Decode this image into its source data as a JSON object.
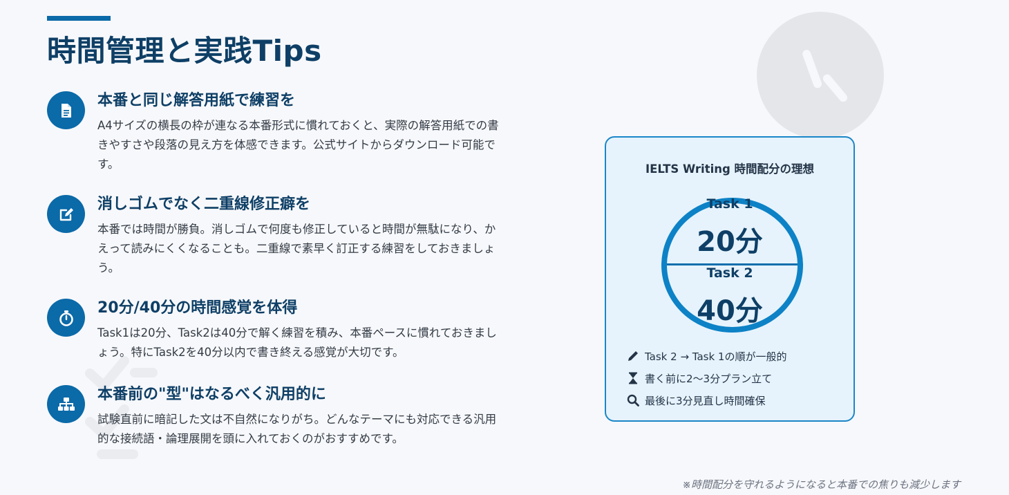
{
  "title": "時間管理と実践Tips",
  "colors": {
    "accent": "#0b6aa8",
    "heading": "#0e3f66",
    "card_bg": "#e6f3fc",
    "card_border": "#1a86c8"
  },
  "tips": [
    {
      "icon": "document-icon",
      "title": "本番と同じ解答用紙で練習を",
      "desc": "A4サイズの横長の枠が連なる本番形式に慣れておくと、実際の解答用紙での書きやすさや段落の見え方を体感できます。公式サイトからダウンロード可能です。"
    },
    {
      "icon": "edit-icon",
      "title": "消しゴムでなく二重線修正癖を",
      "desc": "本番では時間が勝負。消しゴムで何度も修正していると時間が無駄になり、かえって読みにくくなることも。二重線で素早く訂正する練習をしておきましょう。"
    },
    {
      "icon": "stopwatch-icon",
      "title": "20分/40分の時間感覚を体得",
      "desc": "Task1は20分、Task2は40分で解く練習を積み、本番ペースに慣れておきましょう。特にTask2を40分以内で書き終える感覚が大切です。"
    },
    {
      "icon": "sitemap-icon",
      "title": "本番前の\"型\"はなるべく汎用的に",
      "desc": "試験直前に暗記した文は不自然になりがち。どんなテーマにも対応できる汎用的な接続語・論理展開を頭に入れておくのがおすすめです。"
    }
  ],
  "card": {
    "title": "IELTS Writing 時間配分の理想",
    "task1_label": "Task 1",
    "task1_time": "20分",
    "task2_label": "Task 2",
    "task2_time": "40分",
    "items": [
      {
        "icon": "pencil-icon",
        "text": "Task 2 → Task 1の順が一般的"
      },
      {
        "icon": "hourglass-icon",
        "text": "書く前に2〜3分プラン立て"
      },
      {
        "icon": "search-icon",
        "text": "最後に3分見直し時間確保"
      }
    ]
  },
  "footnote": "※時間配分を守れるようになると本番での焦りも減少します"
}
